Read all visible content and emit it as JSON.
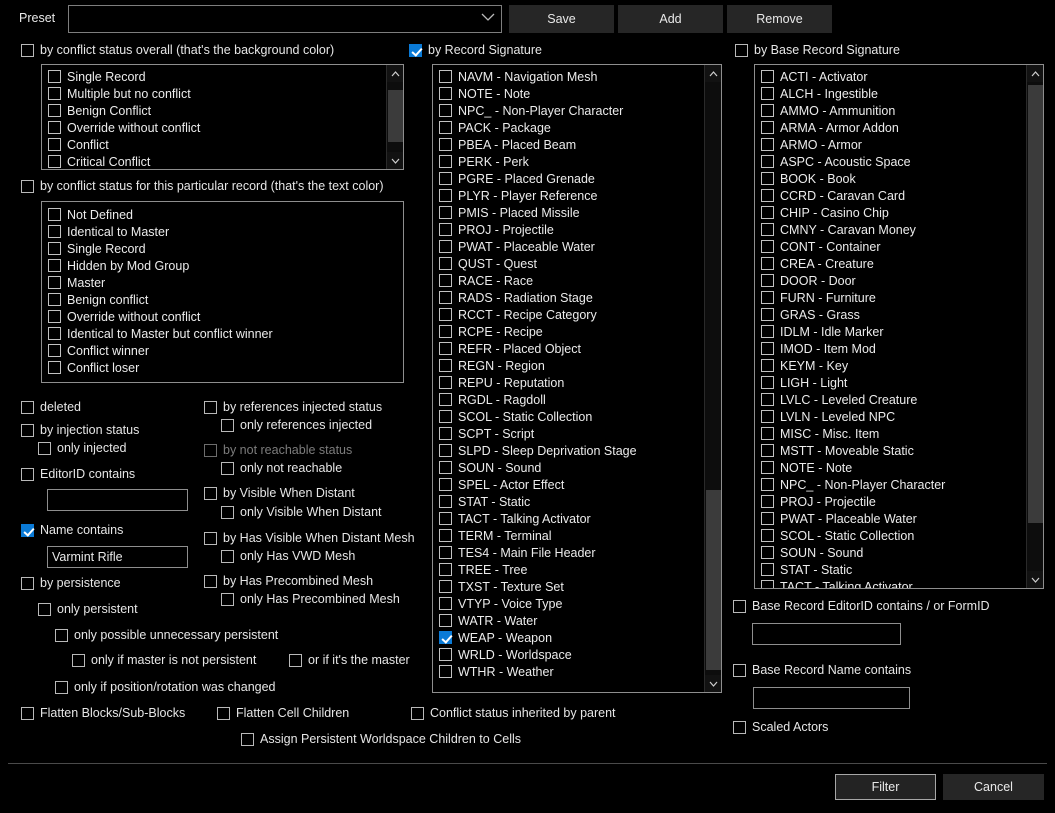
{
  "preset": {
    "label": "Preset",
    "value": "",
    "chevron": "chevron-down-icon",
    "buttons": [
      {
        "id": "save",
        "label": "Save"
      },
      {
        "id": "add",
        "label": "Add"
      },
      {
        "id": "remove",
        "label": "Remove"
      }
    ]
  },
  "conflict_overall": {
    "label": "by conflict status overall (that's the background color)",
    "checked": false,
    "items": [
      {
        "label": "Single Record",
        "checked": false
      },
      {
        "label": "Multiple but no conflict",
        "checked": false
      },
      {
        "label": "Benign Conflict",
        "checked": false
      },
      {
        "label": "Override without conflict",
        "checked": false
      },
      {
        "label": "Conflict",
        "checked": false
      },
      {
        "label": "Critical Conflict",
        "checked": false
      }
    ],
    "scroll": {
      "thumb_top_pct": 20,
      "thumb_height_pct": 55
    }
  },
  "conflict_record": {
    "label": "by conflict status for this particular record  (that's the text color)",
    "checked": false,
    "items": [
      {
        "label": "Not Defined",
        "checked": false
      },
      {
        "label": "Identical to Master",
        "checked": false
      },
      {
        "label": "Single Record",
        "checked": false
      },
      {
        "label": "Hidden by Mod Group",
        "checked": false
      },
      {
        "label": "Master",
        "checked": false
      },
      {
        "label": "Benign conflict",
        "checked": false
      },
      {
        "label": "Override without conflict",
        "checked": false
      },
      {
        "label": "Identical to Master but conflict winner",
        "checked": false
      },
      {
        "label": "Conflict winner",
        "checked": false
      },
      {
        "label": "Conflict loser",
        "checked": false
      }
    ]
  },
  "left_options": [
    {
      "id": "deleted",
      "label": "deleted",
      "checked": false,
      "indent": 0
    },
    {
      "id": "by-injection-status",
      "label": "by injection status",
      "checked": false,
      "indent": 0
    },
    {
      "id": "only-injected",
      "label": "only injected",
      "checked": false,
      "indent": 1
    },
    {
      "id": "editorid-contains",
      "label": "EditorID contains",
      "checked": false,
      "indent": 0
    },
    {
      "id": "name-contains",
      "label": "Name contains",
      "checked": true,
      "indent": 0
    },
    {
      "id": "by-persistence",
      "label": "by persistence",
      "checked": false,
      "indent": 0
    },
    {
      "id": "only-persistent",
      "label": "only persistent",
      "checked": false,
      "indent": 1
    },
    {
      "id": "only-possible-unnecessary-persistent",
      "label": "only possible unnecessary persistent",
      "checked": false,
      "indent": 2
    },
    {
      "id": "only-if-master-is-not-persistent",
      "label": "only if master is not persistent",
      "checked": false,
      "indent": 3
    },
    {
      "id": "or-if-its-the-master",
      "label": "or if it's the master",
      "checked": false,
      "indent": 0
    },
    {
      "id": "only-if-position-rotation-was-changed",
      "label": "only if position/rotation was changed",
      "checked": false,
      "indent": 2
    }
  ],
  "editorid_field": {
    "value": "",
    "placeholder": ""
  },
  "name_field": {
    "value": "Varmint Rifle",
    "placeholder": ""
  },
  "mid_options": [
    {
      "id": "by-references-injected-status",
      "label": "by references injected status",
      "checked": false,
      "disabled": false
    },
    {
      "id": "only-references-injected",
      "label": "only references injected",
      "checked": false,
      "disabled": false
    },
    {
      "id": "by-not-reachable-status",
      "label": "by not reachable status",
      "checked": false,
      "disabled": true
    },
    {
      "id": "only-not-reachable",
      "label": "only not reachable",
      "checked": false,
      "disabled": false
    },
    {
      "id": "by-visible-when-distant",
      "label": "by Visible When Distant",
      "checked": false,
      "disabled": false
    },
    {
      "id": "only-visible-when-distant",
      "label": "only Visible When Distant",
      "checked": false,
      "disabled": false
    },
    {
      "id": "by-has-visible-when-distant-mesh",
      "label": "by Has Visible When Distant Mesh",
      "checked": false,
      "disabled": false
    },
    {
      "id": "only-has-vwd-mesh",
      "label": "only Has VWD Mesh",
      "checked": false,
      "disabled": false
    },
    {
      "id": "by-has-precombined-mesh",
      "label": "by Has Precombined Mesh",
      "checked": false,
      "disabled": false
    },
    {
      "id": "only-has-precombined-mesh",
      "label": "only Has Precombined Mesh",
      "checked": false,
      "disabled": false
    }
  ],
  "record_signature": {
    "label": "by Record Signature",
    "checked": true,
    "items": [
      {
        "label": "NAVM - Navigation Mesh",
        "checked": false
      },
      {
        "label": "NOTE - Note",
        "checked": false
      },
      {
        "label": "NPC_ - Non-Player Character",
        "checked": false
      },
      {
        "label": "PACK - Package",
        "checked": false
      },
      {
        "label": "PBEA - Placed Beam",
        "checked": false
      },
      {
        "label": "PERK - Perk",
        "checked": false
      },
      {
        "label": "PGRE - Placed Grenade",
        "checked": false
      },
      {
        "label": "PLYR - Player Reference",
        "checked": false
      },
      {
        "label": "PMIS - Placed Missile",
        "checked": false
      },
      {
        "label": "PROJ - Projectile",
        "checked": false
      },
      {
        "label": "PWAT - Placeable Water",
        "checked": false
      },
      {
        "label": "QUST - Quest",
        "checked": false
      },
      {
        "label": "RACE - Race",
        "checked": false
      },
      {
        "label": "RADS - Radiation Stage",
        "checked": false
      },
      {
        "label": "RCCT - Recipe Category",
        "checked": false
      },
      {
        "label": "RCPE - Recipe",
        "checked": false
      },
      {
        "label": "REFR - Placed Object",
        "checked": false
      },
      {
        "label": "REGN - Region",
        "checked": false
      },
      {
        "label": "REPU - Reputation",
        "checked": false
      },
      {
        "label": "RGDL - Ragdoll",
        "checked": false
      },
      {
        "label": "SCOL - Static Collection",
        "checked": false
      },
      {
        "label": "SCPT - Script",
        "checked": false
      },
      {
        "label": "SLPD - Sleep Deprivation Stage",
        "checked": false
      },
      {
        "label": "SOUN - Sound",
        "checked": false
      },
      {
        "label": "SPEL - Actor Effect",
        "checked": false
      },
      {
        "label": "STAT - Static",
        "checked": false
      },
      {
        "label": "TACT - Talking Activator",
        "checked": false
      },
      {
        "label": "TERM - Terminal",
        "checked": false
      },
      {
        "label": "TES4 - Main File Header",
        "checked": false
      },
      {
        "label": "TREE - Tree",
        "checked": false
      },
      {
        "label": "TXST - Texture Set",
        "checked": false
      },
      {
        "label": "VTYP - Voice Type",
        "checked": false
      },
      {
        "label": "WATR - Water",
        "checked": false
      },
      {
        "label": "WEAP - Weapon",
        "checked": true
      },
      {
        "label": "WRLD - Worldspace",
        "checked": false
      },
      {
        "label": "WTHR - Weather",
        "checked": false
      }
    ],
    "scroll": {
      "thumb_top_pct": 73,
      "thumb_height_pct": 24
    }
  },
  "base_record_signature": {
    "label": "by Base Record Signature",
    "checked": false,
    "items": [
      {
        "label": "ACTI - Activator",
        "checked": false
      },
      {
        "label": "ALCH - Ingestible",
        "checked": false
      },
      {
        "label": "AMMO - Ammunition",
        "checked": false
      },
      {
        "label": "ARMA - Armor Addon",
        "checked": false
      },
      {
        "label": "ARMO - Armor",
        "checked": false
      },
      {
        "label": "ASPC - Acoustic Space",
        "checked": false
      },
      {
        "label": "BOOK - Book",
        "checked": false
      },
      {
        "label": "CCRD - Caravan Card",
        "checked": false
      },
      {
        "label": "CHIP - Casino Chip",
        "checked": false
      },
      {
        "label": "CMNY - Caravan Money",
        "checked": false
      },
      {
        "label": "CONT - Container",
        "checked": false
      },
      {
        "label": "CREA - Creature",
        "checked": false
      },
      {
        "label": "DOOR - Door",
        "checked": false
      },
      {
        "label": "FURN - Furniture",
        "checked": false
      },
      {
        "label": "GRAS - Grass",
        "checked": false
      },
      {
        "label": "IDLM - Idle Marker",
        "checked": false
      },
      {
        "label": "IMOD - Item Mod",
        "checked": false
      },
      {
        "label": "KEYM - Key",
        "checked": false
      },
      {
        "label": "LIGH - Light",
        "checked": false
      },
      {
        "label": "LVLC - Leveled Creature",
        "checked": false
      },
      {
        "label": "LVLN - Leveled NPC",
        "checked": false
      },
      {
        "label": "MISC - Misc. Item",
        "checked": false
      },
      {
        "label": "MSTT - Moveable Static",
        "checked": false
      },
      {
        "label": "NOTE - Note",
        "checked": false
      },
      {
        "label": "NPC_ - Non-Player Character",
        "checked": false
      },
      {
        "label": "PROJ - Projectile",
        "checked": false
      },
      {
        "label": "PWAT - Placeable Water",
        "checked": false
      },
      {
        "label": "SCOL - Static Collection",
        "checked": false
      },
      {
        "label": "SOUN - Sound",
        "checked": false
      },
      {
        "label": "STAT - Static",
        "checked": false
      },
      {
        "label": "TACT - Talking Activator",
        "checked": false
      }
    ],
    "scroll": {
      "thumb_top_pct": 3,
      "thumb_height_pct": 88
    }
  },
  "base_record_editorid": {
    "label": "Base Record EditorID contains / or FormID",
    "checked": false,
    "value": "",
    "placeholder": ""
  },
  "base_record_name": {
    "label": "Base Record Name contains",
    "checked": false,
    "value": "",
    "placeholder": ""
  },
  "scaled_actors": {
    "label": "Scaled Actors",
    "checked": false
  },
  "bottom_options": [
    {
      "id": "flatten-blocks-sub-blocks",
      "label": "Flatten Blocks/Sub-Blocks",
      "checked": false
    },
    {
      "id": "flatten-cell-children",
      "label": "Flatten Cell Children",
      "checked": false
    },
    {
      "id": "conflict-status-inherited-by-parent",
      "label": "Conflict status inherited by parent",
      "checked": false
    },
    {
      "id": "assign-persistent-worldspace-children-to-cells",
      "label": "Assign Persistent Worldspace Children to Cells",
      "checked": false
    }
  ],
  "dialog_buttons": [
    {
      "id": "filter",
      "label": "Filter",
      "default": true
    },
    {
      "id": "cancel",
      "label": "Cancel",
      "default": false
    }
  ],
  "colors": {
    "background": "#000000",
    "accent": "#0a7ad6",
    "border": "#8e8e8e",
    "text": "#e9e9e9",
    "disabled_text": "#7c7c7c",
    "button_face": "#262626"
  }
}
